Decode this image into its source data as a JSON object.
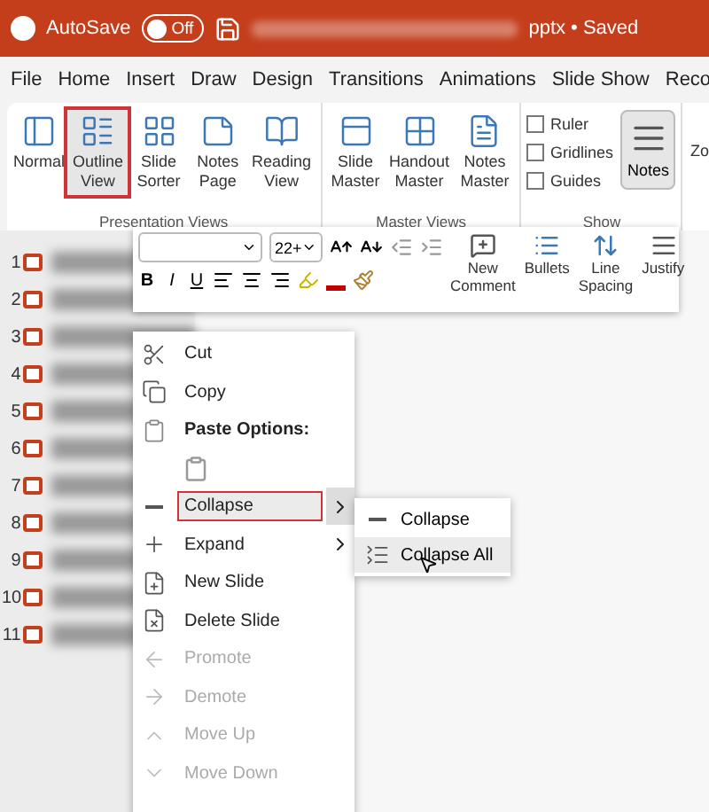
{
  "title_bar": {
    "autosave_label": "AutoSave",
    "autosave_on": false,
    "toggle_text": "Off",
    "title": "pptx • Saved"
  },
  "menu_tabs": [
    "File",
    "Home",
    "Insert",
    "Draw",
    "Design",
    "Transitions",
    "Animations",
    "Slide Show",
    "Reco"
  ],
  "ribbon": {
    "groups": [
      {
        "label": "Presentation Views",
        "kind": "views",
        "buttons": [
          {
            "label": "Normal",
            "selected": false
          },
          {
            "label": "Outline View",
            "selected": true
          },
          {
            "label": "Slide Sorter",
            "selected": false
          },
          {
            "label": "Notes Page",
            "selected": false
          },
          {
            "label": "Reading View",
            "selected": false
          }
        ]
      },
      {
        "label": "Master Views",
        "kind": "masters",
        "buttons": [
          {
            "label": "Slide Master",
            "selected": false
          },
          {
            "label": "Handout Master",
            "selected": false
          },
          {
            "label": "Notes Master",
            "selected": false
          }
        ]
      },
      {
        "label": "Show",
        "kind": "show",
        "checkboxes": [
          {
            "label": "Ruler",
            "checked": false
          },
          {
            "label": "Gridlines",
            "checked": false
          },
          {
            "label": "Guides",
            "checked": false
          }
        ],
        "notes_button": {
          "label": "Notes",
          "selected": true
        }
      }
    ],
    "cut_label": "Zo"
  },
  "outline": {
    "slides": [
      "1",
      "2",
      "3",
      "4",
      "5",
      "6",
      "7",
      "8",
      "9",
      "10",
      "11"
    ]
  },
  "mini_toolbar": {
    "size": "22+",
    "bold": "B",
    "italic": "I",
    "underline": "U",
    "new_comment": "New Comment",
    "bullets": "Bullets",
    "line_spacing": "Line Spacing",
    "justify": "Justify"
  },
  "context_menu": {
    "items": [
      {
        "kind": "item",
        "label": "Cut",
        "disabled": false
      },
      {
        "kind": "item",
        "label": "Copy",
        "disabled": false
      },
      {
        "kind": "header",
        "label": "Paste Options:"
      },
      {
        "kind": "paste"
      },
      {
        "kind": "submenu",
        "label": "Collapse",
        "selected": true
      },
      {
        "kind": "submenu",
        "label": "Expand",
        "selected": false
      },
      {
        "kind": "item",
        "label": "New Slide",
        "disabled": false
      },
      {
        "kind": "item",
        "label": "Delete Slide",
        "disabled": false
      },
      {
        "kind": "item",
        "label": "Promote",
        "disabled": true
      },
      {
        "kind": "item",
        "label": "Demote",
        "disabled": true
      },
      {
        "kind": "item",
        "label": "Move Up",
        "disabled": true
      },
      {
        "kind": "item",
        "label": "Move Down",
        "disabled": true
      }
    ]
  },
  "submenu": {
    "items": [
      {
        "label": "Collapse",
        "selected": false
      },
      {
        "label": "Collapse All",
        "selected": true
      }
    ]
  }
}
